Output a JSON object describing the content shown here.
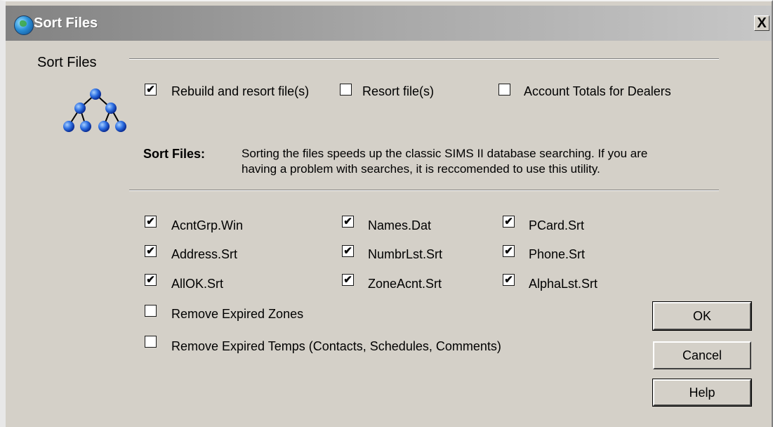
{
  "window": {
    "title": "Sort Files",
    "close_glyph": "X"
  },
  "section": {
    "title": "Sort Files"
  },
  "mode_options": [
    {
      "label": "Rebuild and resort file(s)",
      "checked": true
    },
    {
      "label": "Resort file(s)",
      "checked": false
    },
    {
      "label": "Account Totals for Dealers",
      "checked": false
    }
  ],
  "description": {
    "heading": "Sort Files:",
    "line1": "Sorting the files speeds up the classic SIMS II database searching. If you are",
    "line2": "having a problem with searches, it is reccomended to use this utility."
  },
  "files": {
    "col1": [
      {
        "label": "AcntGrp.Win",
        "checked": true
      },
      {
        "label": "Address.Srt",
        "checked": true
      },
      {
        "label": "AllOK.Srt",
        "checked": true
      }
    ],
    "col2": [
      {
        "label": "Names.Dat",
        "checked": true
      },
      {
        "label": "NumbrLst.Srt",
        "checked": true
      },
      {
        "label": "ZoneAcnt.Srt",
        "checked": true
      }
    ],
    "col3": [
      {
        "label": "PCard.Srt",
        "checked": true
      },
      {
        "label": "Phone.Srt",
        "checked": true
      },
      {
        "label": "AlphaLst.Srt",
        "checked": true
      }
    ]
  },
  "extra_options": [
    {
      "label": "Remove Expired Zones",
      "checked": false
    },
    {
      "label": "Remove Expired Temps (Contacts, Schedules, Comments)",
      "checked": false
    }
  ],
  "buttons": {
    "ok": "OK",
    "cancel": "Cancel",
    "help": "Help"
  },
  "check_glyph": "✔",
  "icons": {
    "app": "globe-icon",
    "tree": "tree-network-icon"
  }
}
